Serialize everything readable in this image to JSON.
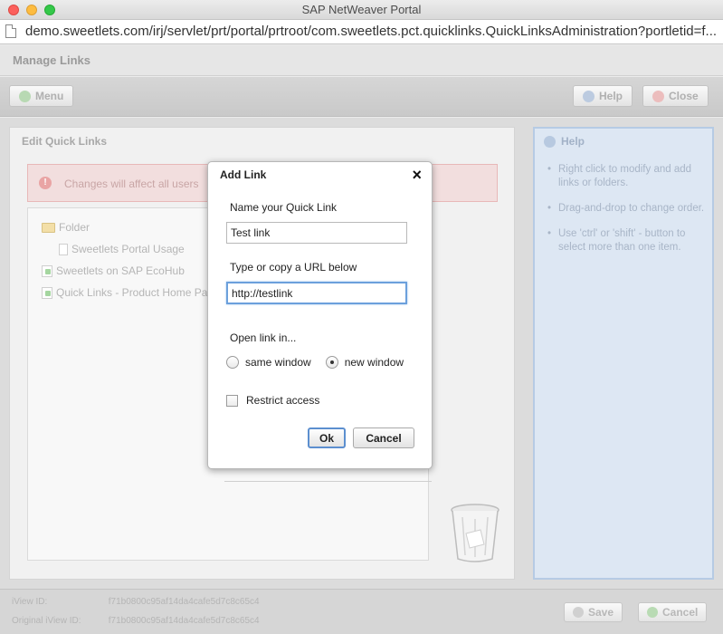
{
  "window": {
    "title": "SAP NetWeaver Portal",
    "url": "demo.sweetlets.com/irj/servlet/prt/portal/prtroot/com.sweetlets.pct.quicklinks.QuickLinksAdministration?portletid=f..."
  },
  "portal": {
    "title": "Manage Links",
    "toolbar": {
      "menu_label": "Menu",
      "help_label": "Help",
      "close_label": "Close"
    }
  },
  "edit_panel": {
    "title": "Edit Quick Links",
    "warning": "Changes will affect all users",
    "tree": [
      {
        "label": "Folder",
        "kind": "folder"
      },
      {
        "label": "Sweetlets Portal Usage",
        "kind": "document"
      },
      {
        "label": "Sweetlets on SAP EcoHub",
        "kind": "link"
      },
      {
        "label": "Quick Links - Product Home Pa",
        "kind": "link"
      }
    ]
  },
  "help_panel": {
    "title": "Help",
    "items": [
      "Right click to modify and add links or folders.",
      "Drag-and-drop to change order.",
      "Use 'ctrl' or 'shift' - button to select more than one item."
    ]
  },
  "footer": {
    "iview_id_label": "iView ID:",
    "iview_id_value": "f71b0800c95af14da4cafe5d7c8c65c4",
    "original_iview_id_label": "Original iView ID:",
    "original_iview_id_value": "f71b0800c95af14da4cafe5d7c8c65c4",
    "save_label": "Save",
    "cancel_label": "Cancel"
  },
  "dialog": {
    "title": "Add Link",
    "close_glyph": "×",
    "name_label": "Name your Quick Link",
    "name_value": "Test link",
    "url_label": "Type or copy a URL below",
    "url_value": "http://testlink",
    "open_in_label": "Open link in...",
    "option_same": "same window",
    "option_new": "new window",
    "selected_option": "new window",
    "restrict_label": "Restrict access",
    "restrict_checked": false,
    "ok_label": "Ok",
    "cancel_label": "Cancel"
  },
  "colors": {
    "dialog_focus": "#6ca0dc",
    "warning_bg": "#f2dede",
    "help_bg": "#dde7f3"
  }
}
